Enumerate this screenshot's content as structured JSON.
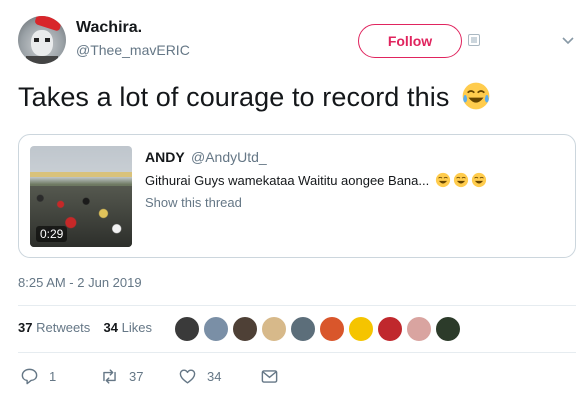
{
  "author": {
    "display_name": "Wachira.",
    "handle": "@Thee_mavERIC",
    "avatar_icon": "profile-avatar"
  },
  "follow": {
    "label": "Follow",
    "accent_color": "#e0245e"
  },
  "tweet": {
    "text": "Takes a lot of courage to record this",
    "emoji": "face-with-tears-of-joy-emoji"
  },
  "quoted": {
    "name": "ANDY",
    "handle": "@AndyUtd_",
    "text": "Githurai Guys wamekataa Waititu aongee Bana...",
    "emoji_count": 3,
    "show_thread": "Show this thread",
    "video_duration": "0:29"
  },
  "timestamp": "8:25 AM - 2 Jun 2019",
  "stats": {
    "retweets_count": "37",
    "retweets_label": "Retweets",
    "likes_count": "34",
    "likes_label": "Likes"
  },
  "likers_colors": [
    "#3a3a3a",
    "#7a8fa6",
    "#4e4036",
    "#d7b98a",
    "#5c6e7a",
    "#d9562b",
    "#f5c400",
    "#c0282d",
    "#d9a4a0",
    "#2c3b2a"
  ],
  "actions": {
    "reply_count": "1",
    "retweet_count": "37",
    "like_count": "34"
  },
  "colors": {
    "text": "#14171a",
    "secondary": "#657786",
    "border": "#ccd6dd"
  }
}
